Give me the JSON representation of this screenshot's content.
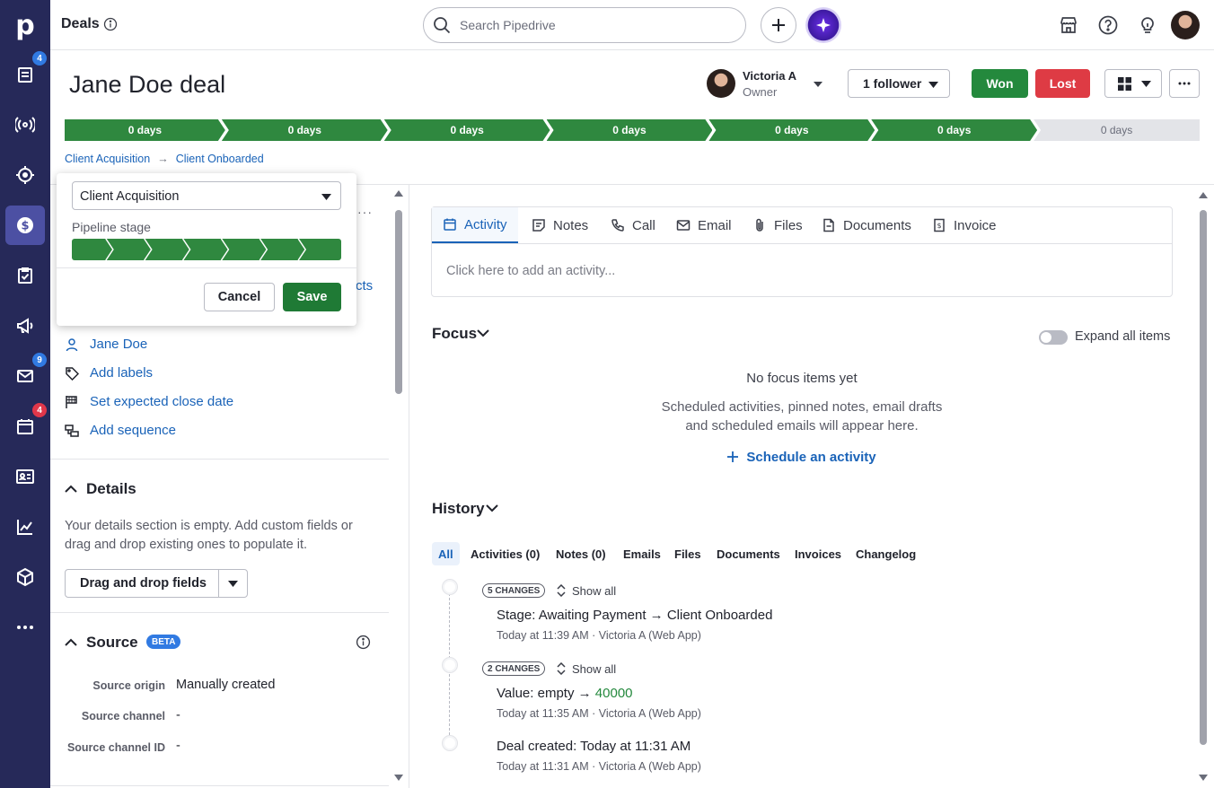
{
  "app": {
    "logo_letter": "p",
    "search_placeholder": "Search Pipedrive"
  },
  "rail": {
    "badges": {
      "deals_list": "4",
      "mail": "9",
      "calendar": "4"
    }
  },
  "header": {
    "page_title": "Deals"
  },
  "deal": {
    "title": "Jane Doe deal",
    "owner_name": "Victoria A",
    "owner_role": "Owner",
    "followers_label": "1 follower",
    "won_label": "Won",
    "lost_label": "Lost",
    "stages": [
      "0 days",
      "0 days",
      "0 days",
      "0 days",
      "0 days",
      "0 days",
      "0 days"
    ],
    "stages_completed": 6,
    "breadcrumb": [
      "Client Acquisition",
      "Client Onboarded"
    ]
  },
  "popup": {
    "pipeline_value": "Client Acquisition",
    "stage_label": "Pipeline stage",
    "stage_count": 7,
    "cancel_label": "Cancel",
    "save_label": "Save"
  },
  "left": {
    "contacts_fragment": "cts",
    "person": "Jane Doe",
    "add_labels": "Add labels",
    "close_date": "Set expected close date",
    "add_sequence": "Add sequence",
    "details_title": "Details",
    "details_text": "Your details section is empty. Add custom fields or drag and drop existing ones to populate it.",
    "dnd_label": "Drag and drop fields",
    "source_title": "Source",
    "beta": "BETA",
    "source_rows": [
      {
        "label": "Source origin",
        "value": "Manually created"
      },
      {
        "label": "Source channel",
        "value": "-"
      },
      {
        "label": "Source channel ID",
        "value": "-"
      }
    ]
  },
  "composer": {
    "tabs": [
      "Activity",
      "Notes",
      "Call",
      "Email",
      "Files",
      "Documents",
      "Invoice"
    ],
    "active_tab": "Activity",
    "placeholder": "Click here to add an activity..."
  },
  "focus": {
    "title": "Focus",
    "expand_label": "Expand all items",
    "empty_title": "No focus items yet",
    "empty_desc_1": "Scheduled activities, pinned notes, email drafts",
    "empty_desc_2": "and scheduled emails will appear here.",
    "schedule_link": "Schedule an activity"
  },
  "history": {
    "title": "History",
    "filters": [
      "All",
      "Activities (0)",
      "Notes (0)",
      "Emails",
      "Files",
      "Documents",
      "Invoices",
      "Changelog"
    ],
    "active_filter": "All",
    "entries": [
      {
        "badge": "5 CHANGES",
        "show_all": "Show all",
        "field": "Stage",
        "text": "Awaiting Payment → Client Onboarded",
        "meta": "Today at 11:39 AM · Victoria A (Web App)"
      },
      {
        "badge": "2 CHANGES",
        "show_all": "Show all",
        "field": "Value",
        "text_prefix": "empty → ",
        "text_value": "40000",
        "meta": "Today at 11:35 AM · Victoria A (Web App)"
      },
      {
        "field": "Deal created",
        "text": "Today at 11:31 AM",
        "meta": "Today at 11:31 AM · Victoria A (Web App)"
      }
    ]
  },
  "colors": {
    "rail": "#262959",
    "rail_active": "#4c50a3",
    "stage_done": "#2f883f",
    "won": "#24893d",
    "lost": "#de3b44",
    "link": "#1a63b8"
  }
}
